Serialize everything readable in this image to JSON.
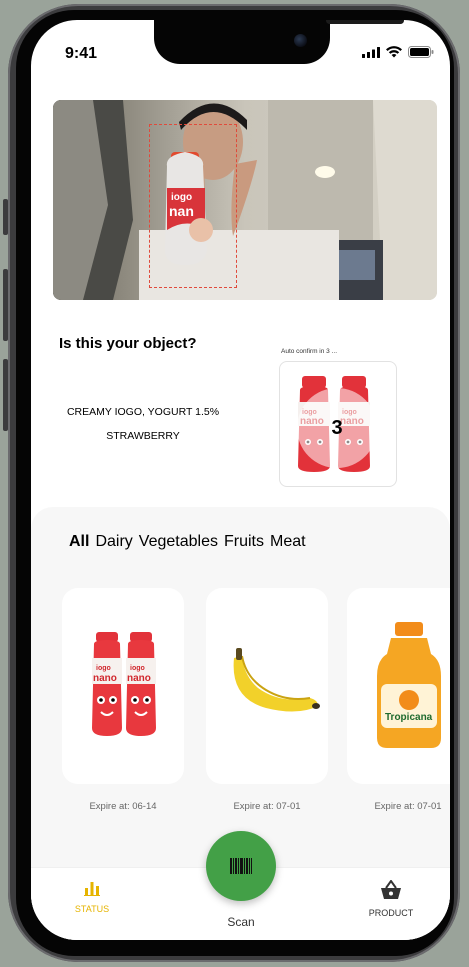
{
  "status_bar": {
    "time": "9:41"
  },
  "detection": {
    "question": "Is this your object?",
    "product_name_line1": "CREAMY IOGO, YOGURT 1.5%",
    "product_name_line2": "STRAWBERRY",
    "auto_confirm": "Auto confirm in 3 ...",
    "countdown": "3"
  },
  "categories": {
    "tabs": [
      "All",
      "Dairy",
      "Vegetables",
      "Fruits",
      "Meat"
    ],
    "selected": "All"
  },
  "products": [
    {
      "name": "iogo nano yogurt",
      "expire": "Expire at: 06-14"
    },
    {
      "name": "banana",
      "expire": "Expire at: 07-01"
    },
    {
      "name": "tropicana orange juice",
      "expire": "Expire at: 07-01"
    }
  ],
  "bottom_nav": {
    "status_label": "STATUS",
    "scan_label": "Scan",
    "product_label": "PRODUCT",
    "active": "STATUS"
  },
  "colors": {
    "accent_green": "#43a047",
    "active_yellow": "#e6b400",
    "scan_box": "#e04a3b"
  }
}
